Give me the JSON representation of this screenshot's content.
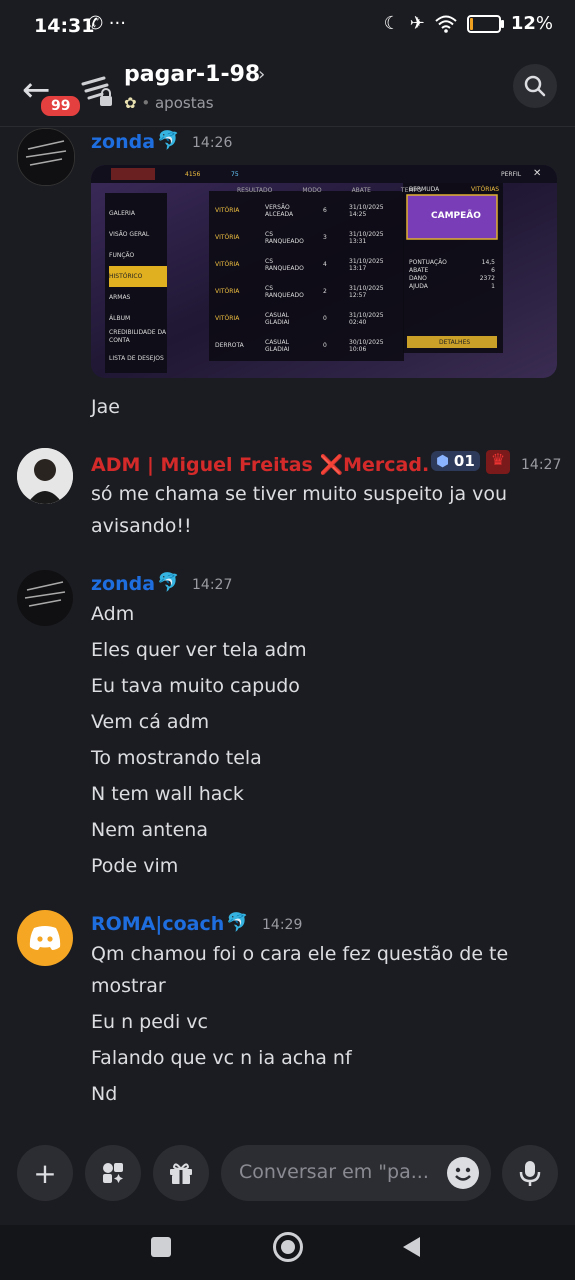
{
  "status": {
    "time": "14:31",
    "extra_icons": "✆ ···",
    "battery_level": 0.12,
    "battery_pct": "12"
  },
  "header": {
    "badge": "99",
    "channel_name": "pagar-1-98",
    "subtitle": "apostas"
  },
  "messages": [
    {
      "author": "zonda",
      "time": "14:26",
      "lines": [
        "Jae"
      ]
    },
    {
      "author": "ADM | Miguel Freitas ❌Mercad...",
      "time": "14:27",
      "role_badge": "01",
      "lines": [
        "só me chama se tiver muito suspeito ja vou",
        "avisando!!"
      ]
    },
    {
      "author": "zonda",
      "time": "14:27",
      "lines": [
        "Adm",
        "Eles quer ver tela adm",
        "Eu tava muito capudo",
        "Vem cá adm",
        "To mostrando tela",
        "N tem wall hack",
        "Nem antena",
        "Pode vim"
      ]
    },
    {
      "author": "ROMA|coach",
      "time": "14:29",
      "lines": [
        "Qm chamou foi o cara ele fez questão de te",
        "mostrar",
        "Eu n pedi vc",
        "Falando que vc n ia acha nf",
        "Nd"
      ]
    }
  ],
  "attachment": {
    "menu": [
      "GALERIA",
      "VISÃO GERAL",
      "FUNÇÃO",
      "HISTÓRICO",
      "ARMAS",
      "ÁLBUM",
      "CREDIBILIDADE DA CONTA",
      "LISTA DE DESEJOS"
    ],
    "columns": [
      "RESULTADO",
      "MODO",
      "ABATE",
      "TEMPO"
    ],
    "rows": [
      {
        "result": "VITÓRIA",
        "mode": "VERSÃO ALCEADA",
        "kills": "6",
        "date": "31/10/2025 14:25"
      },
      {
        "result": "VITÓRIA",
        "mode": "CS RANQUEADO",
        "kills": "3",
        "date": "31/10/2025 13:31"
      },
      {
        "result": "VITÓRIA",
        "mode": "CS RANQUEADO",
        "kills": "4",
        "date": "31/10/2025 13:17"
      },
      {
        "result": "VITÓRIA",
        "mode": "CS RANQUEADO",
        "kills": "2",
        "date": "31/10/2025 12:57"
      },
      {
        "result": "VITÓRIA",
        "mode": "CASUAL GLADIAI",
        "kills": "0",
        "date": "31/10/2025 02:40"
      },
      {
        "result": "DERROTA",
        "mode": "CASUAL GLADIAI",
        "kills": "0",
        "date": "30/10/2025 10:06"
      }
    ],
    "panel_title": "BERMUDA",
    "panel_result": "VITÓRIAS",
    "champion": "CAMPEÃO",
    "stats": [
      [
        "PONTUAÇÃO",
        "14,5"
      ],
      [
        "ABATE",
        "6"
      ],
      [
        "DANO",
        "2372"
      ],
      [
        "AJUDA",
        "1"
      ]
    ],
    "details_button": "DETALHES",
    "top_coins": "4156",
    "top_diamonds": "75",
    "top_profile": "PERFIL"
  },
  "composer": {
    "placeholder": "Conversar em \"pa..."
  }
}
